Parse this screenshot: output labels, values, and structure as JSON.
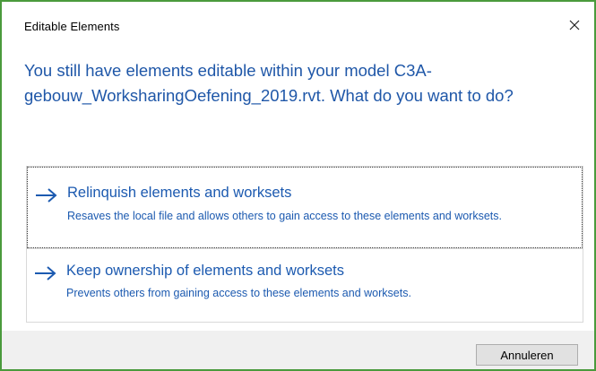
{
  "dialog": {
    "title": "Editable Elements",
    "close_icon": "close-icon",
    "question": "You still have elements editable within your model C3A-gebouw_WorksharingOefening_2019.rvt. What do you want to do?",
    "options": [
      {
        "icon": "arrow-right-icon",
        "title": "Relinquish elements and worksets",
        "description": "Resaves the local file and allows others to gain access to these elements and worksets."
      },
      {
        "icon": "arrow-right-icon",
        "title": "Keep ownership of elements and worksets",
        "description": "Prevents others from gaining access to these elements and worksets."
      }
    ],
    "cancel_label": "Annuleren",
    "colors": {
      "accent": "#1c5ab0",
      "border": "#4a9a3c",
      "footer": "#f0f0f0"
    }
  }
}
